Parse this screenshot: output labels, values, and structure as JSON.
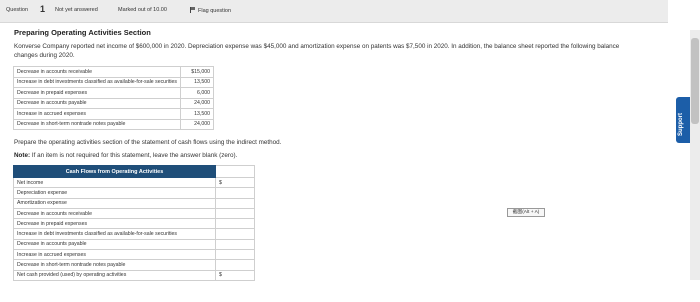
{
  "question_bar": {
    "question_label": "Question",
    "question_number": "1",
    "status": "Not yet answered",
    "marks": "Marked out of 10.00",
    "flag_label": "Flag question"
  },
  "section_title": "Preparing Operating Activities Section",
  "intro_text": "Konverse Company reported net income of $600,000 in 2020. Depreciation expense was $45,000 and amortization expense on patents was $7,500 in 2020. In addition, the balance sheet reported the following balance changes during 2020.",
  "balance_changes": [
    {
      "label": "Decrease in accounts receivable",
      "value": "$15,000"
    },
    {
      "label": "Increase in debt investments classified as available-for-sale securities",
      "value": "13,500"
    },
    {
      "label": "Decrease in prepaid expenses",
      "value": "6,000"
    },
    {
      "label": "Decrease in accounts payable",
      "value": "24,000"
    },
    {
      "label": "Increase in accrued expenses",
      "value": "13,500"
    },
    {
      "label": "Decrease in short-term nontrade notes payable",
      "value": "24,000"
    }
  ],
  "prompt": "Prepare the operating activities section of the statement of cash flows using the indirect method.",
  "note_label": "Note:",
  "note_text": "If an item is not required for this statement, leave the answer blank (zero).",
  "cash_flow_table": {
    "header": "Cash Flows from Operating Activities",
    "rows": [
      {
        "label": "Net income",
        "currency": "$"
      },
      {
        "label": "Depreciation expense",
        "currency": ""
      },
      {
        "label": "Amortization expense",
        "currency": ""
      },
      {
        "label": "Decrease in accounts receivable",
        "currency": ""
      },
      {
        "label": "Decrease in prepaid expenses",
        "currency": ""
      },
      {
        "label": "Increase in debt investments classified as available-for-sale securities",
        "currency": ""
      },
      {
        "label": "Decrease in accounts payable",
        "currency": ""
      },
      {
        "label": "Increase in accrued expenses",
        "currency": ""
      },
      {
        "label": "Decrease in short-term nontrade notes payable",
        "currency": ""
      },
      {
        "label": "Net cash provided (used) by operating activities",
        "currency": "$"
      }
    ]
  },
  "ime_hint": "截图(Alt + A)",
  "support_label": "Support",
  "colors": {
    "header_bg": "#1f4e79",
    "support_bg": "#1c5ea8"
  }
}
